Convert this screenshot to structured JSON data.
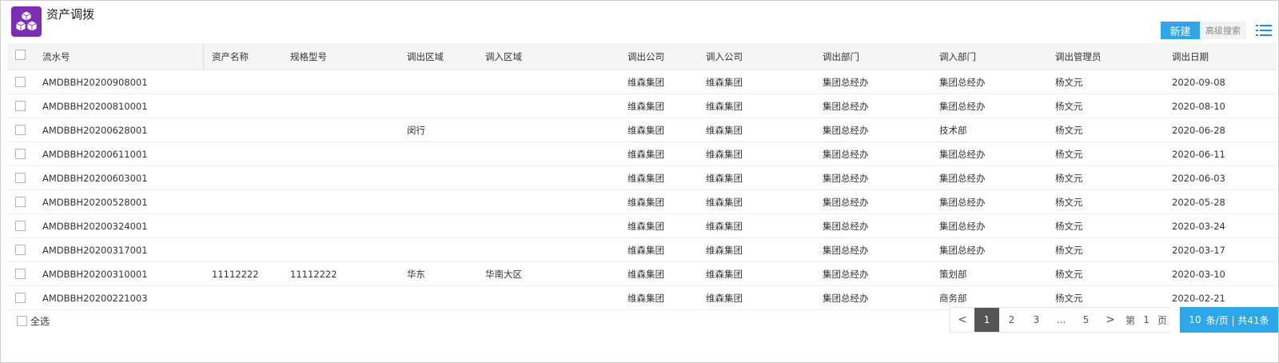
{
  "app": {
    "title": "资产调拨",
    "icon": "cubes-icon",
    "accent": "#7b2db3"
  },
  "toolbar": {
    "new_label": "新建",
    "advanced_search_label": "高级搜索",
    "list_icon": "list-icon",
    "button_color": "#2ea7e8"
  },
  "table": {
    "columns": [
      "流水号",
      "资产名称",
      "规格型号",
      "调出区域",
      "调入区域",
      "调出公司",
      "调入公司",
      "调出部门",
      "调入部门",
      "调出管理员",
      "调出日期"
    ],
    "rows": [
      [
        "AMDBBH20200908001",
        "",
        "",
        "",
        "",
        "维森集团",
        "维森集团",
        "集团总经办",
        "集团总经办",
        "杨文元",
        "2020-09-08"
      ],
      [
        "AMDBBH20200810001",
        "",
        "",
        "",
        "",
        "维森集团",
        "维森集团",
        "集团总经办",
        "集团总经办",
        "杨文元",
        "2020-08-10"
      ],
      [
        "AMDBBH20200628001",
        "",
        "",
        "闵行",
        "",
        "维森集团",
        "维森集团",
        "集团总经办",
        "技术部",
        "杨文元",
        "2020-06-28"
      ],
      [
        "AMDBBH20200611001",
        "",
        "",
        "",
        "",
        "维森集团",
        "维森集团",
        "集团总经办",
        "集团总经办",
        "杨文元",
        "2020-06-11"
      ],
      [
        "AMDBBH20200603001",
        "",
        "",
        "",
        "",
        "维森集团",
        "维森集团",
        "集团总经办",
        "集团总经办",
        "杨文元",
        "2020-06-03"
      ],
      [
        "AMDBBH20200528001",
        "",
        "",
        "",
        "",
        "维森集团",
        "维森集团",
        "集团总经办",
        "集团总经办",
        "杨文元",
        "2020-05-28"
      ],
      [
        "AMDBBH20200324001",
        "",
        "",
        "",
        "",
        "维森集团",
        "维森集团",
        "集团总经办",
        "集团总经办",
        "杨文元",
        "2020-03-24"
      ],
      [
        "AMDBBH20200317001",
        "",
        "",
        "",
        "",
        "维森集团",
        "维森集团",
        "集团总经办",
        "集团总经办",
        "杨文元",
        "2020-03-17"
      ],
      [
        "AMDBBH20200310001",
        "11112222",
        "11112222",
        "华东",
        "华南大区",
        "维森集团",
        "维森集团",
        "集团总经办",
        "策划部",
        "杨文元",
        "2020-03-10"
      ],
      [
        "AMDBBH20200221003",
        "",
        "",
        "",
        "",
        "维森集团",
        "维森集团",
        "集团总经办",
        "商务部",
        "杨文元",
        "2020-02-21"
      ]
    ]
  },
  "footer": {
    "select_all_label": "全选"
  },
  "pagination": {
    "prev": "<",
    "pages": [
      "1",
      "2",
      "3",
      "...",
      "5"
    ],
    "active_page": "1",
    "next": ">",
    "goto_prefix": "第",
    "goto_value": "1",
    "goto_suffix": "页",
    "page_size": "10",
    "page_size_label": "条/页 | 共41条"
  }
}
